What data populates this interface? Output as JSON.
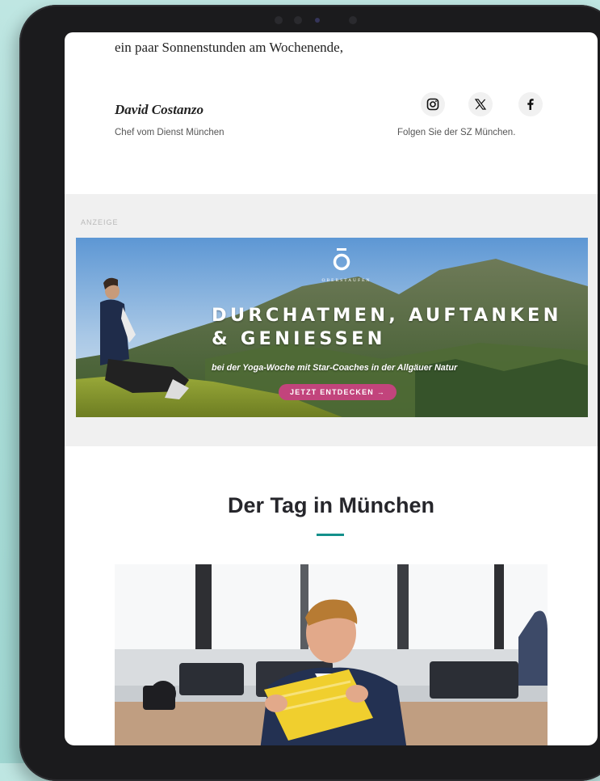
{
  "newsletter": {
    "intro_line": "ein paar Sonnenstunden am Wochenende,",
    "author": {
      "name": "David Costanzo",
      "role": "Chef vom Dienst München"
    },
    "social": {
      "icons": [
        "instagram-icon",
        "x-icon",
        "facebook-icon"
      ],
      "follow_text": "Folgen Sie der SZ München."
    }
  },
  "ad": {
    "label": "ANZEIGE",
    "brand_name": "OBERSTAUFEN",
    "headline_line1": "DURCHATMEN, AUFTANKEN",
    "headline_line2": "& GENIESSEN",
    "subline": "bei der Yoga-Woche mit Star-Coaches in der Allgäuer Natur",
    "cta": "JETZT ENTDECKEN →",
    "cta_color": "#c2447c"
  },
  "section": {
    "title": "Der Tag in München",
    "accent_color": "#14908b"
  }
}
